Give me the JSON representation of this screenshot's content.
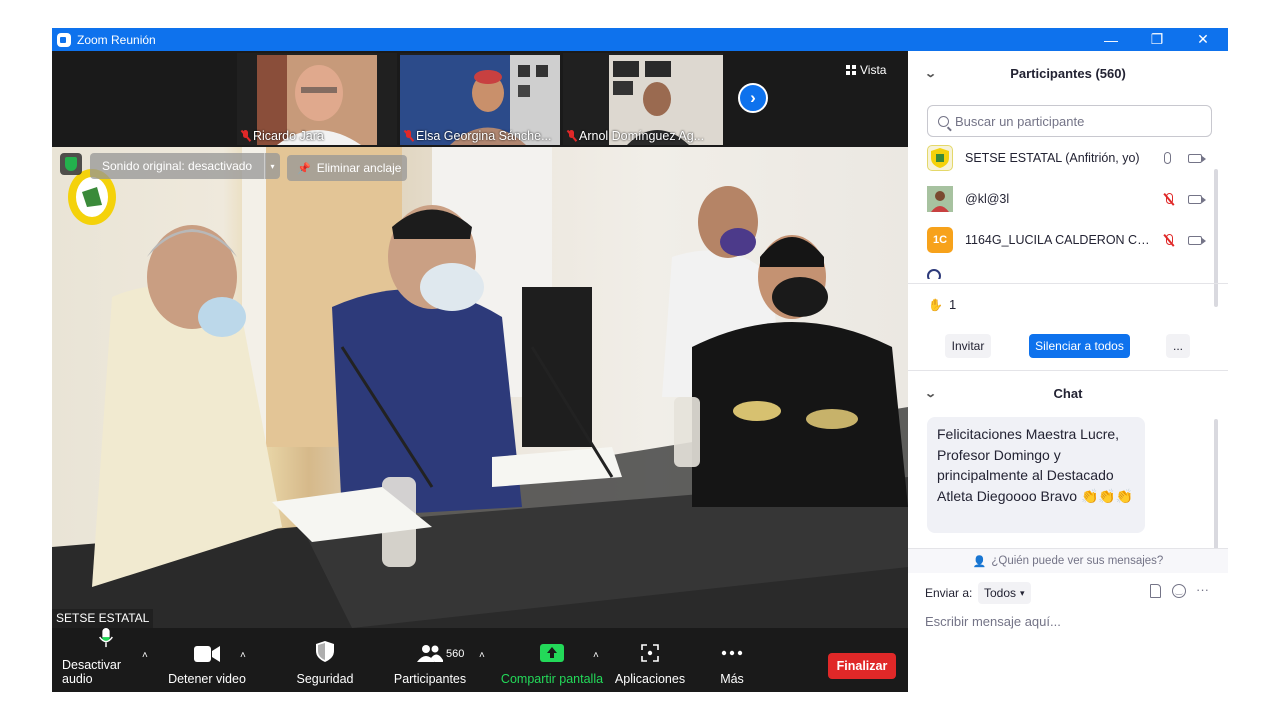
{
  "window": {
    "title": "Zoom Reunión"
  },
  "thumbnails": [
    {
      "name": "Ricardo Jara"
    },
    {
      "name": "Elsa Georgina Sánche..."
    },
    {
      "name": "Arnol Domínguez Ag..."
    }
  ],
  "strip": {
    "view_label": "Vista"
  },
  "main_video": {
    "audio_pill": "Sonido original: desactivado",
    "unpin_label": "Eliminar anclaje",
    "speaker_name": "SETSE ESTATAL"
  },
  "toolbar": {
    "mute_label": "Desactivar audio",
    "video_label": "Detener video",
    "security_label": "Seguridad",
    "participants_label": "Participantes",
    "participants_count": "560",
    "share_label": "Compartir pantalla",
    "apps_label": "Aplicaciones",
    "more_label": "Más",
    "end_label": "Finalizar"
  },
  "participants_panel": {
    "title": "Participantes (560)",
    "search_placeholder": "Buscar un participante",
    "list": [
      {
        "name": "SETSE ESTATAL (Anfitrión, yo)",
        "avatar": "",
        "mic": "on"
      },
      {
        "name": "@kl@3l",
        "avatar": "",
        "mic": "muted"
      },
      {
        "name": "1164G_LUCILA CALDERON CAR...",
        "avatar": "1C",
        "mic": "muted"
      }
    ],
    "raised_hands": "1",
    "invite_label": "Invitar",
    "mute_all_label": "Silenciar a todos",
    "more_label": "..."
  },
  "chat": {
    "title": "Chat",
    "message": "Felicitaciones Maestra Lucre, Profesor Domingo y principalmente al Destacado Atleta Diegoooo Bravo 👏👏👏",
    "visibility_label": "¿Quién puede ver sus mensajes?",
    "send_to_label": "Enviar a:",
    "send_to_value": "Todos",
    "input_placeholder": "Escribir mensaje aquí..."
  },
  "colors": {
    "accent": "#0e72ed",
    "end": "#e02828",
    "share": "#23d959"
  }
}
